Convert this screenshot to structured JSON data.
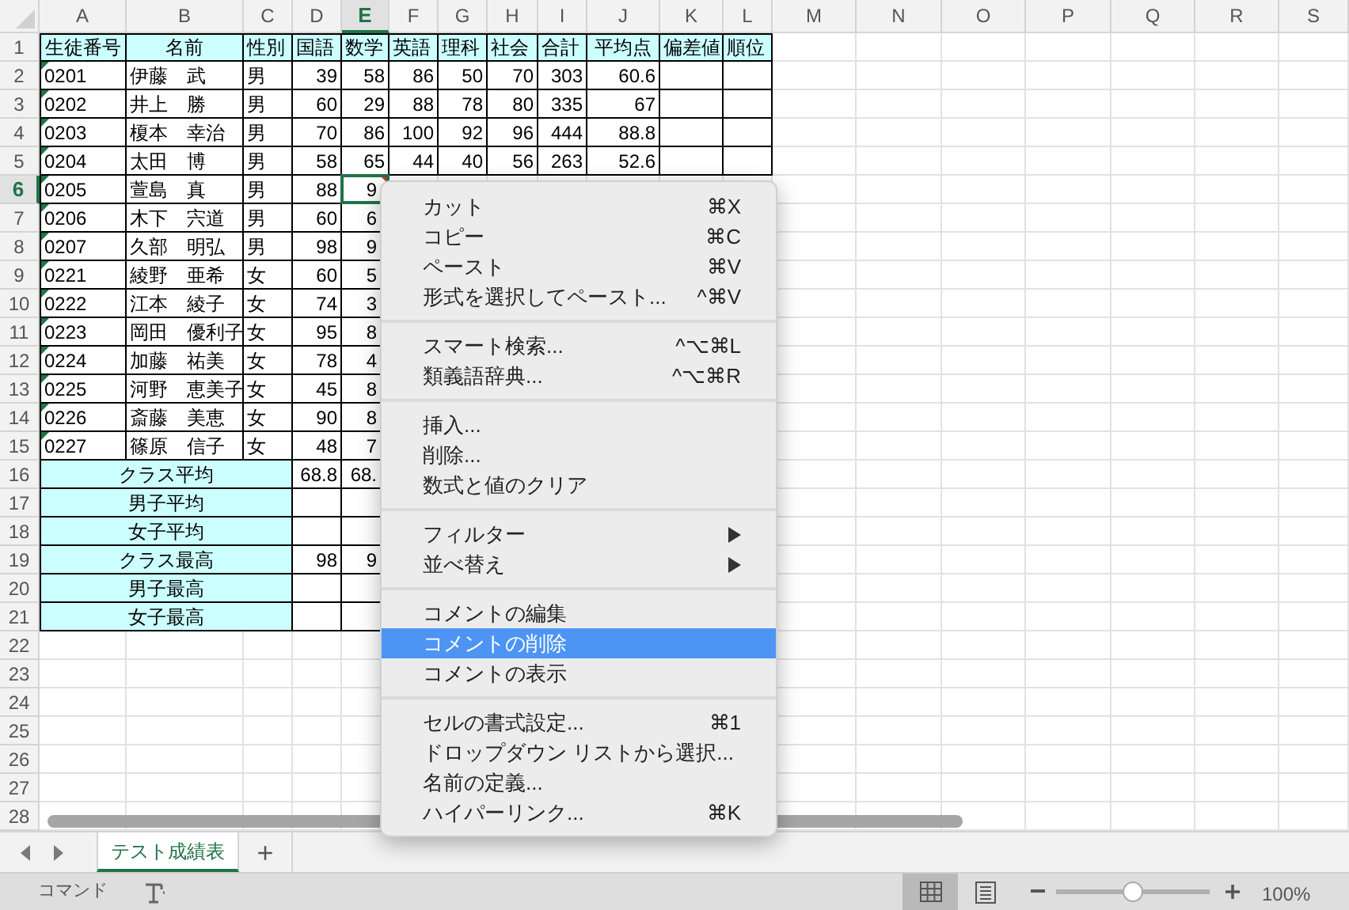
{
  "column_headers": [
    {
      "label": "A",
      "selected": false
    },
    {
      "label": "B",
      "selected": false
    },
    {
      "label": "C",
      "selected": false
    },
    {
      "label": "D",
      "selected": false
    },
    {
      "label": "E",
      "selected": true
    },
    {
      "label": "F",
      "selected": false
    },
    {
      "label": "G",
      "selected": false
    },
    {
      "label": "H",
      "selected": false
    },
    {
      "label": "I",
      "selected": false
    },
    {
      "label": "J",
      "selected": false
    },
    {
      "label": "K",
      "selected": false
    },
    {
      "label": "L",
      "selected": false
    },
    {
      "label": "M",
      "selected": false
    },
    {
      "label": "N",
      "selected": false
    },
    {
      "label": "O",
      "selected": false
    },
    {
      "label": "P",
      "selected": false
    },
    {
      "label": "Q",
      "selected": false
    },
    {
      "label": "R",
      "selected": false
    },
    {
      "label": "S",
      "selected": false
    }
  ],
  "row_headers": [
    {
      "label": "1",
      "selected": false
    },
    {
      "label": "2",
      "selected": false
    },
    {
      "label": "3",
      "selected": false
    },
    {
      "label": "4",
      "selected": false
    },
    {
      "label": "5",
      "selected": false
    },
    {
      "label": "6",
      "selected": true
    },
    {
      "label": "7",
      "selected": false
    },
    {
      "label": "8",
      "selected": false
    },
    {
      "label": "9",
      "selected": false
    },
    {
      "label": "10",
      "selected": false
    },
    {
      "label": "11",
      "selected": false
    },
    {
      "label": "12",
      "selected": false
    },
    {
      "label": "13",
      "selected": false
    },
    {
      "label": "14",
      "selected": false
    },
    {
      "label": "15",
      "selected": false
    },
    {
      "label": "16",
      "selected": false
    },
    {
      "label": "17",
      "selected": false
    },
    {
      "label": "18",
      "selected": false
    },
    {
      "label": "19",
      "selected": false
    },
    {
      "label": "20",
      "selected": false
    },
    {
      "label": "21",
      "selected": false
    },
    {
      "label": "22",
      "selected": false
    },
    {
      "label": "23",
      "selected": false
    },
    {
      "label": "24",
      "selected": false
    },
    {
      "label": "25",
      "selected": false
    },
    {
      "label": "26",
      "selected": false
    },
    {
      "label": "27",
      "selected": false
    },
    {
      "label": "28",
      "selected": false
    }
  ],
  "header_row": [
    "生徒番号",
    "名前",
    "性別",
    "国語",
    "数学",
    "英語",
    "理科",
    "社会",
    "合計",
    "平均点",
    "偏差値",
    "順位"
  ],
  "students": [
    {
      "id": "0201",
      "text_marker": true,
      "name": "伊藤　武",
      "gender": "男",
      "scores": [
        "39",
        "58",
        "86",
        "50",
        "70",
        "303",
        "60.6"
      ],
      "comment": false
    },
    {
      "id": "0202",
      "text_marker": true,
      "name": "井上　勝",
      "gender": "男",
      "scores": [
        "60",
        "29",
        "88",
        "78",
        "80",
        "335",
        "67"
      ],
      "comment": false
    },
    {
      "id": "0203",
      "text_marker": true,
      "name": "榎本　幸治",
      "gender": "男",
      "scores": [
        "70",
        "86",
        "100",
        "92",
        "96",
        "444",
        "88.8"
      ],
      "comment": false
    },
    {
      "id": "0204",
      "text_marker": true,
      "name": "太田　博",
      "gender": "男",
      "scores": [
        "58",
        "65",
        "44",
        "40",
        "56",
        "263",
        "52.6"
      ],
      "comment": false
    },
    {
      "id": "0205",
      "text_marker": true,
      "name": "萱島　真",
      "gender": "男",
      "scores": [
        "88",
        "9"
      ],
      "comment": true
    },
    {
      "id": "0206",
      "text_marker": true,
      "name": "木下　宍道",
      "gender": "男",
      "scores": [
        "60",
        "6"
      ],
      "comment": false
    },
    {
      "id": "0207",
      "text_marker": true,
      "name": "久部　明弘",
      "gender": "男",
      "scores": [
        "98",
        "9"
      ],
      "comment": false
    },
    {
      "id": "0221",
      "text_marker": true,
      "name": "綾野　亜希",
      "gender": "女",
      "scores": [
        "60",
        "5"
      ],
      "comment": false
    },
    {
      "id": "0222",
      "text_marker": true,
      "name": "江本　綾子",
      "gender": "女",
      "scores": [
        "74",
        "3"
      ],
      "comment": false
    },
    {
      "id": "0223",
      "text_marker": true,
      "name": "岡田　優利子",
      "gender": "女",
      "scores": [
        "95",
        "8"
      ],
      "comment": false
    },
    {
      "id": "0224",
      "text_marker": true,
      "name": "加藤　祐美",
      "gender": "女",
      "scores": [
        "78",
        "4"
      ],
      "comment": false
    },
    {
      "id": "0225",
      "text_marker": true,
      "name": "河野　恵美子",
      "gender": "女",
      "scores": [
        "45",
        "8"
      ],
      "comment": false
    },
    {
      "id": "0226",
      "text_marker": true,
      "name": "斎藤　美恵",
      "gender": "女",
      "scores": [
        "90",
        "8"
      ],
      "comment": false
    },
    {
      "id": "0227",
      "text_marker": true,
      "name": "篠原　信子",
      "gender": "女",
      "scores": [
        "48",
        "7"
      ],
      "comment": false
    }
  ],
  "summary_rows": [
    {
      "label": "クラス平均",
      "values": [
        "68.8",
        "68."
      ]
    },
    {
      "label": "男子平均"
    },
    {
      "label": "女子平均"
    },
    {
      "label": "クラス最高",
      "values": [
        "98",
        "9"
      ]
    },
    {
      "label": "男子最高"
    },
    {
      "label": "女子最高"
    }
  ],
  "context_menu": [
    {
      "kind": "item",
      "label": "カット",
      "shortcut": "⌘X",
      "selected": false
    },
    {
      "kind": "item",
      "label": "コピー",
      "shortcut": "⌘C",
      "selected": false
    },
    {
      "kind": "item",
      "label": "ペースト",
      "shortcut": "⌘V",
      "selected": false
    },
    {
      "kind": "item",
      "label": "形式を選択してペースト...",
      "shortcut": "^⌘V",
      "selected": false
    },
    {
      "kind": "separator"
    },
    {
      "kind": "item",
      "label": "スマート検索...",
      "shortcut": "^⌥⌘L",
      "selected": false
    },
    {
      "kind": "item",
      "label": "類義語辞典...",
      "shortcut": "^⌥⌘R",
      "selected": false
    },
    {
      "kind": "separator"
    },
    {
      "kind": "item",
      "label": "挿入...",
      "selected": false
    },
    {
      "kind": "item",
      "label": "削除...",
      "selected": false
    },
    {
      "kind": "item",
      "label": "数式と値のクリア",
      "selected": false
    },
    {
      "kind": "separator"
    },
    {
      "kind": "submenu",
      "label": "フィルター",
      "selected": false
    },
    {
      "kind": "submenu",
      "label": "並べ替え",
      "selected": false
    },
    {
      "kind": "separator"
    },
    {
      "kind": "item",
      "label": "コメントの編集",
      "selected": false
    },
    {
      "kind": "item",
      "label": "コメントの削除",
      "selected": true
    },
    {
      "kind": "item",
      "label": "コメントの表示",
      "selected": false
    },
    {
      "kind": "separator"
    },
    {
      "kind": "item",
      "label": "セルの書式設定...",
      "shortcut": "⌘1",
      "selected": false
    },
    {
      "kind": "item",
      "label": "ドロップダウン リストから選択...",
      "selected": false
    },
    {
      "kind": "item",
      "label": "名前の定義...",
      "selected": false
    },
    {
      "kind": "item",
      "label": "ハイパーリンク...",
      "shortcut": "⌘K",
      "selected": false
    }
  ],
  "sheet_tabs": [
    {
      "label": "テスト成績表",
      "selected": true
    }
  ],
  "add_sheet": "+",
  "status_bar": {
    "mode": "コマンド",
    "views": [
      {
        "selected": true
      },
      {
        "selected": false
      }
    ],
    "zoom": {
      "level": 0.5,
      "reading": "100%"
    }
  }
}
